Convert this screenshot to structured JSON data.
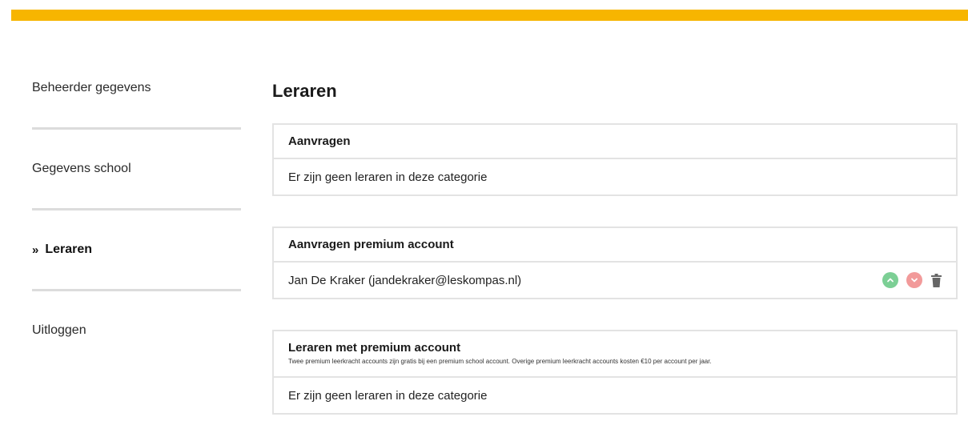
{
  "sidebar": {
    "items": [
      {
        "label": "Beheerder gegevens",
        "active": false
      },
      {
        "label": "Gegevens school",
        "active": false
      },
      {
        "label": "Leraren",
        "active": true,
        "prefix": "»"
      },
      {
        "label": "Uitloggen",
        "active": false
      }
    ]
  },
  "main": {
    "title": "Leraren",
    "panels": [
      {
        "title": "Aanvragen",
        "rows": [
          "Er zijn geen leraren in deze categorie"
        ]
      },
      {
        "title": "Aanvragen premium account",
        "rows": [
          "Jan De Kraker (jandekraker@leskompas.nl)"
        ]
      },
      {
        "title": "Leraren met premium account",
        "note": "Twee premium leerkracht accounts zijn gratis bij een premium school account. Overige premium leerkracht accounts kosten €10 per account per jaar.",
        "rows": [
          "Er zijn geen leraren in deze categorie"
        ]
      }
    ]
  },
  "colors": {
    "accent": "#f7b500",
    "approve": "#7ccf95",
    "reject": "#f29a9a",
    "border": "#e3e3e3"
  },
  "icons": {
    "active_marker": "double-chevron-right-icon",
    "approve": "chevron-up-icon",
    "reject": "chevron-down-icon",
    "delete": "trash-icon"
  }
}
